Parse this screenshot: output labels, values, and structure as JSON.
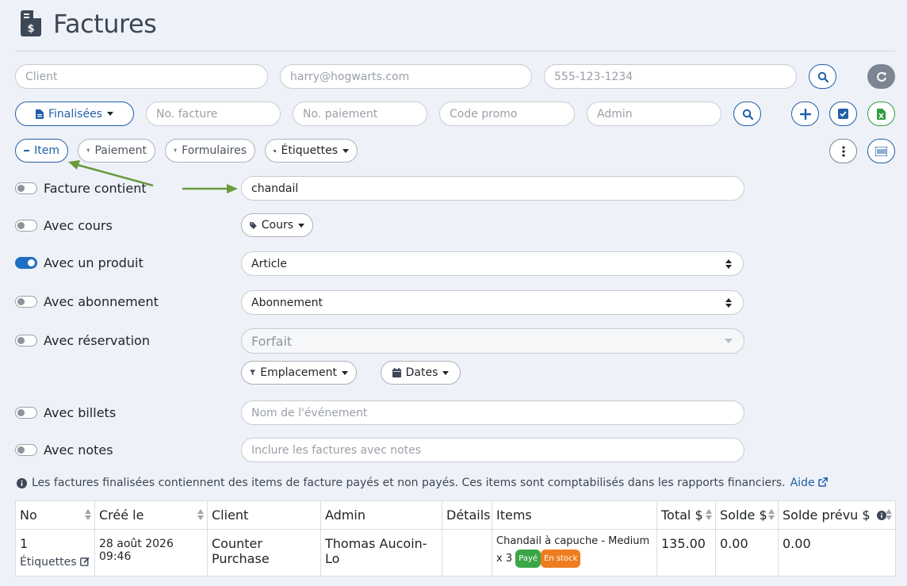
{
  "page": {
    "title": "Factures"
  },
  "search_row1": {
    "client_placeholder": "Client",
    "email_placeholder": "harry@hogwarts.com",
    "phone_placeholder": "555-123-1234"
  },
  "search_row2": {
    "status_label": "Finalisées",
    "invoice_no_placeholder": "No. facture",
    "payment_no_placeholder": "No. paiement",
    "promo_placeholder": "Code promo",
    "admin_placeholder": "Admin"
  },
  "filters": {
    "item_label": "Item",
    "payment_label": "Paiement",
    "forms_label": "Formulaires",
    "tags_label": "Étiquettes"
  },
  "options": {
    "invoice_contains": {
      "label": "Facture contient",
      "value": "chandail",
      "on": false
    },
    "with_courses": {
      "label": "Avec cours",
      "button": "Cours",
      "on": false
    },
    "with_product": {
      "label": "Avec un produit",
      "select": "Article",
      "on": true
    },
    "with_subscription": {
      "label": "Avec abonnement",
      "select": "Abonnement",
      "on": false
    },
    "with_reservation": {
      "label": "Avec réservation",
      "select": "Forfait",
      "location_label": "Emplacement",
      "dates_label": "Dates",
      "on": false
    },
    "with_tickets": {
      "label": "Avec billets",
      "placeholder": "Nom de l'événement",
      "on": false
    },
    "with_notes": {
      "label": "Avec notes",
      "placeholder": "Inclure les factures avec notes",
      "on": false
    }
  },
  "info": {
    "text": "Les factures finalisées contiennent des items de facture payés et non payés. Ces items sont comptabilisés dans les rapports financiers.",
    "help_link": "Aide"
  },
  "table": {
    "headers": [
      "No",
      "Créé le",
      "Client",
      "Admin",
      "Détails",
      "Items",
      "Total $",
      "Solde $",
      "Solde prévu $"
    ],
    "rows": [
      {
        "no": "1",
        "tags_link": "Étiquettes",
        "created": "28 août 2026 09:46",
        "client": "Counter Purchase",
        "admin": "Thomas Aucoin-Lo",
        "details": "",
        "items": "Chandail à capuche - Medium x 3",
        "badge_paid": "Payé",
        "badge_stock": "En stock",
        "total": "135.00",
        "balance": "0.00",
        "expected_balance": "0.00"
      }
    ]
  },
  "colors": {
    "accent": "#1f5fa8",
    "background": "#eef1f8",
    "arrow": "#6a9a3c",
    "paid": "#3aa647",
    "stock": "#ee7d1f"
  }
}
